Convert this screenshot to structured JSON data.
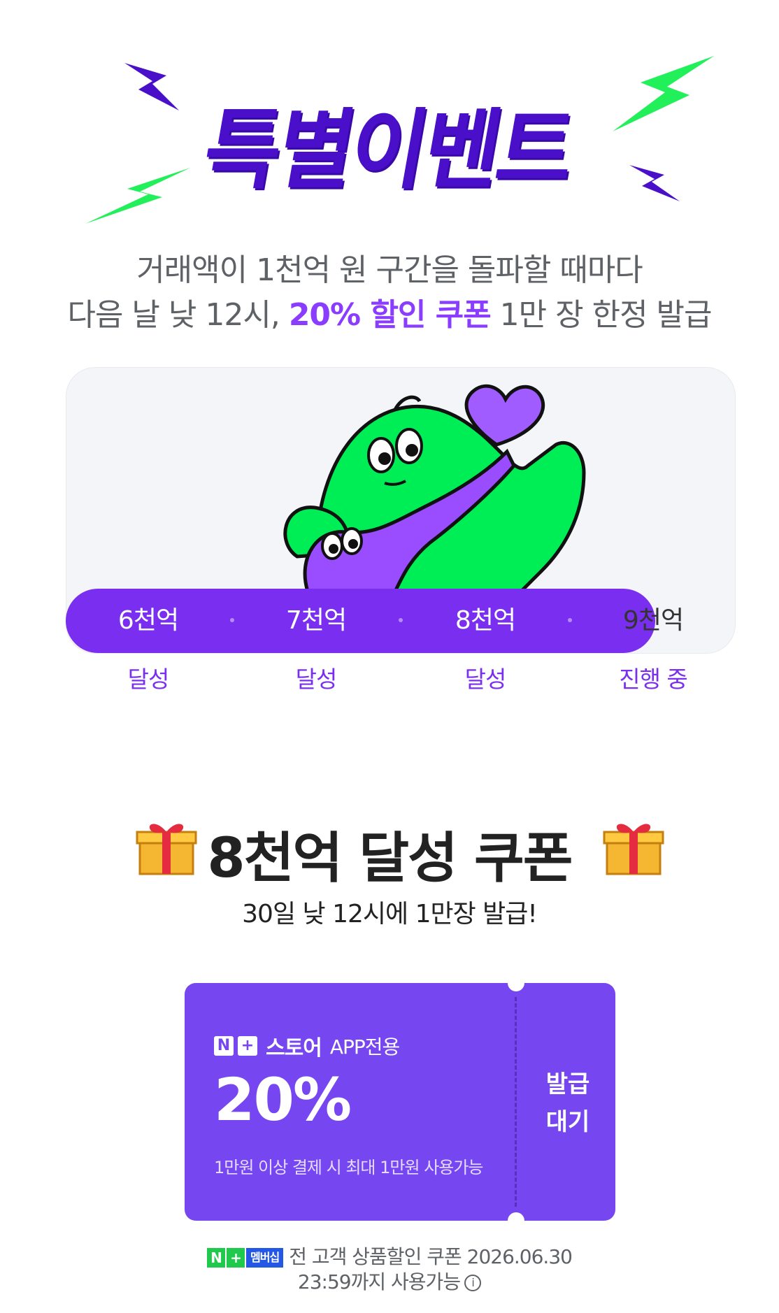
{
  "hero": {
    "title": "특별이벤트",
    "subtitle_line1": "거래액이 1천억 원 구간을 돌파할 때마다",
    "subtitle_line2_prefix": "다음 날 낮 12시, ",
    "subtitle_line2_highlight": "20% 할인 쿠폰",
    "subtitle_line2_suffix": " 1만 장 한정 발급"
  },
  "progress": {
    "fill_fraction": 0.88,
    "milestones": [
      {
        "label": "6천억",
        "status": "달성"
      },
      {
        "label": "7천억",
        "status": "달성"
      },
      {
        "label": "8천억",
        "status": "달성"
      },
      {
        "label": "9천억",
        "status": "진행 중"
      }
    ]
  },
  "coupon_section": {
    "heading": "8천억 달성 쿠폰",
    "subheading": "30일 낮 12시에 1만장 발급!",
    "gift_icon": "wrapped-gift"
  },
  "coupon": {
    "brand_n": "N",
    "brand_plus": "+",
    "brand_store": "스토어",
    "brand_app": "APP전용",
    "value": "20%",
    "condition": "1만원 이상 결제 시 최대 1만원 사용가능",
    "status_line1": "발급",
    "status_line2": "대기"
  },
  "membership": {
    "badge_n": "N",
    "badge_plus": "+",
    "badge_label": "멤버십",
    "text_line1": "전 고객 상품할인 쿠폰 2026.06.30",
    "text_line2": "23:59까지 사용가능",
    "info_icon": "info-circle"
  },
  "colors": {
    "brand_purple": "#7a2ff0",
    "title_purple": "#4a10c9",
    "coupon_purple": "#7646f0",
    "bolt_green": "#22f05a",
    "character_green": "#00ee55",
    "heart_purple": "#a05cff"
  }
}
